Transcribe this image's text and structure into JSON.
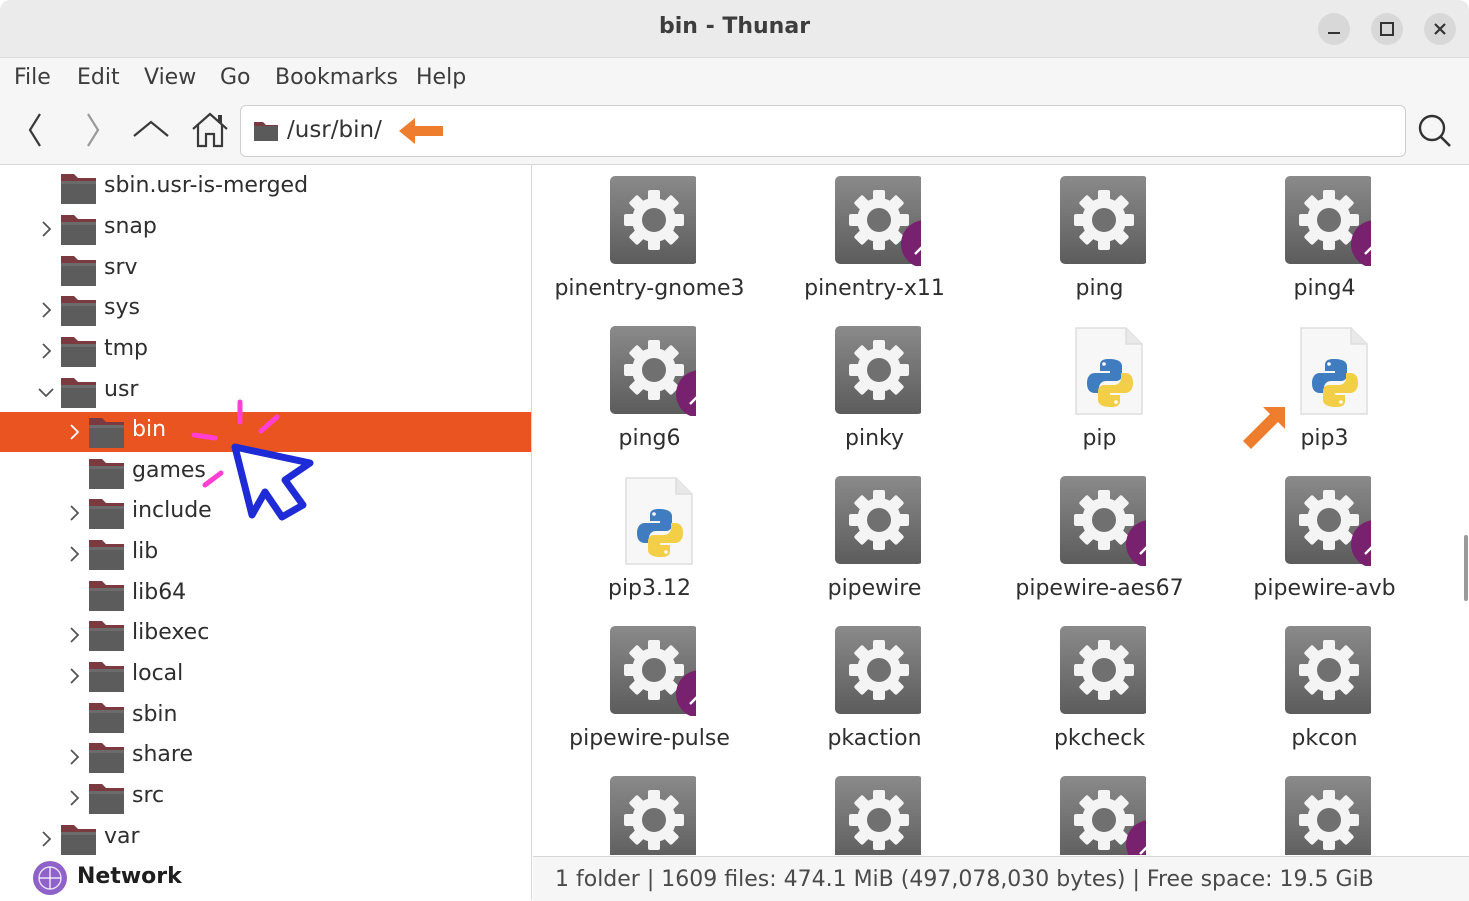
{
  "window": {
    "title": "bin - Thunar"
  },
  "menubar": {
    "items": [
      "File",
      "Edit",
      "Go",
      "View",
      "Bookmarks",
      "Help"
    ]
  },
  "menubar_ordered": {
    "file": "File",
    "edit": "Edit",
    "view": "View",
    "go": "Go",
    "bookmarks": "Bookmarks",
    "help": "Help"
  },
  "location": {
    "path": "/usr/bin/"
  },
  "sidebar": {
    "items": [
      {
        "label": "sbin.usr-is-merged"
      },
      {
        "label": "snap"
      },
      {
        "label": "srv"
      },
      {
        "label": "sys"
      },
      {
        "label": "tmp"
      },
      {
        "label": "usr"
      },
      {
        "label": "bin"
      },
      {
        "label": "games"
      },
      {
        "label": "include"
      },
      {
        "label": "lib"
      },
      {
        "label": "lib64"
      },
      {
        "label": "libexec"
      },
      {
        "label": "local"
      },
      {
        "label": "sbin"
      },
      {
        "label": "share"
      },
      {
        "label": "src"
      },
      {
        "label": "var"
      },
      {
        "label": "Network"
      }
    ]
  },
  "files": [
    {
      "name": "pinentry-gnome3",
      "type": "exec",
      "link": false
    },
    {
      "name": "pinentry-x11",
      "type": "exec",
      "link": true
    },
    {
      "name": "ping",
      "type": "exec",
      "link": false
    },
    {
      "name": "ping4",
      "type": "exec",
      "link": true
    },
    {
      "name": "ping6",
      "type": "exec",
      "link": true
    },
    {
      "name": "pinky",
      "type": "exec",
      "link": false
    },
    {
      "name": "pip",
      "type": "python",
      "link": false
    },
    {
      "name": "pip3",
      "type": "python",
      "link": false
    },
    {
      "name": "pip3.12",
      "type": "python",
      "link": false
    },
    {
      "name": "pipewire",
      "type": "exec",
      "link": false
    },
    {
      "name": "pipewire-aes67",
      "type": "exec",
      "link": true
    },
    {
      "name": "pipewire-avb",
      "type": "exec",
      "link": true
    },
    {
      "name": "pipewire-pulse",
      "type": "exec",
      "link": true
    },
    {
      "name": "pkaction",
      "type": "exec",
      "link": false
    },
    {
      "name": "pkcheck",
      "type": "exec",
      "link": false
    },
    {
      "name": "pkcon",
      "type": "exec",
      "link": false
    },
    {
      "name": "",
      "type": "exec",
      "link": false
    },
    {
      "name": "",
      "type": "exec",
      "link": false
    },
    {
      "name": "",
      "type": "exec",
      "link": true
    },
    {
      "name": "",
      "type": "exec",
      "link": false
    }
  ],
  "statusbar": {
    "text": "1 folder  |  1609 files: 474.1 MiB (497,078,030 bytes)  |  Free space: 19.5 GiB"
  },
  "colors": {
    "accent": "#e95420",
    "folder": "#7a3a3f",
    "link_badge": "#77216f",
    "annotation_arrow": "#ee7d2e",
    "cursor": "#1f2bd6",
    "click_burst": "#ff3ed3"
  }
}
